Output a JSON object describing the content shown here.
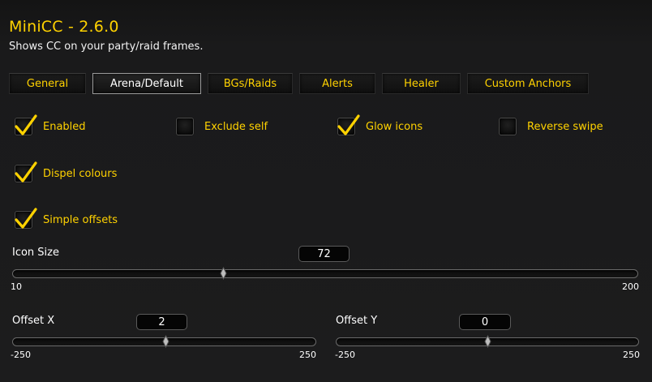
{
  "header": {
    "title": "MiniCC - 2.6.0",
    "subtitle": "Shows CC on your party/raid frames."
  },
  "tabs": [
    {
      "label": "General",
      "active": false
    },
    {
      "label": "Arena/Default",
      "active": true
    },
    {
      "label": "BGs/Raids",
      "active": false
    },
    {
      "label": "Alerts",
      "active": false
    },
    {
      "label": "Healer",
      "active": false
    },
    {
      "label": "Custom Anchors",
      "active": false
    }
  ],
  "options": {
    "enabled": {
      "label": "Enabled",
      "checked": true
    },
    "exclude_self": {
      "label": "Exclude self",
      "checked": false
    },
    "glow_icons": {
      "label": "Glow icons",
      "checked": true
    },
    "reverse_swipe": {
      "label": "Reverse swipe",
      "checked": false
    },
    "dispel_colours": {
      "label": "Dispel colours",
      "checked": true
    },
    "simple_offsets": {
      "label": "Simple offsets",
      "checked": true
    }
  },
  "sliders": {
    "icon_size": {
      "label": "Icon Size",
      "value": "72",
      "min": "10",
      "max": "200"
    },
    "offset_x": {
      "label": "Offset X",
      "value": "2",
      "min": "-250",
      "max": "250"
    },
    "offset_y": {
      "label": "Offset Y",
      "value": "0",
      "min": "-250",
      "max": "250"
    }
  },
  "colors": {
    "accent": "#ffd200",
    "background": "#1c1c1d",
    "active_tab_border": "#9a9a9a"
  }
}
